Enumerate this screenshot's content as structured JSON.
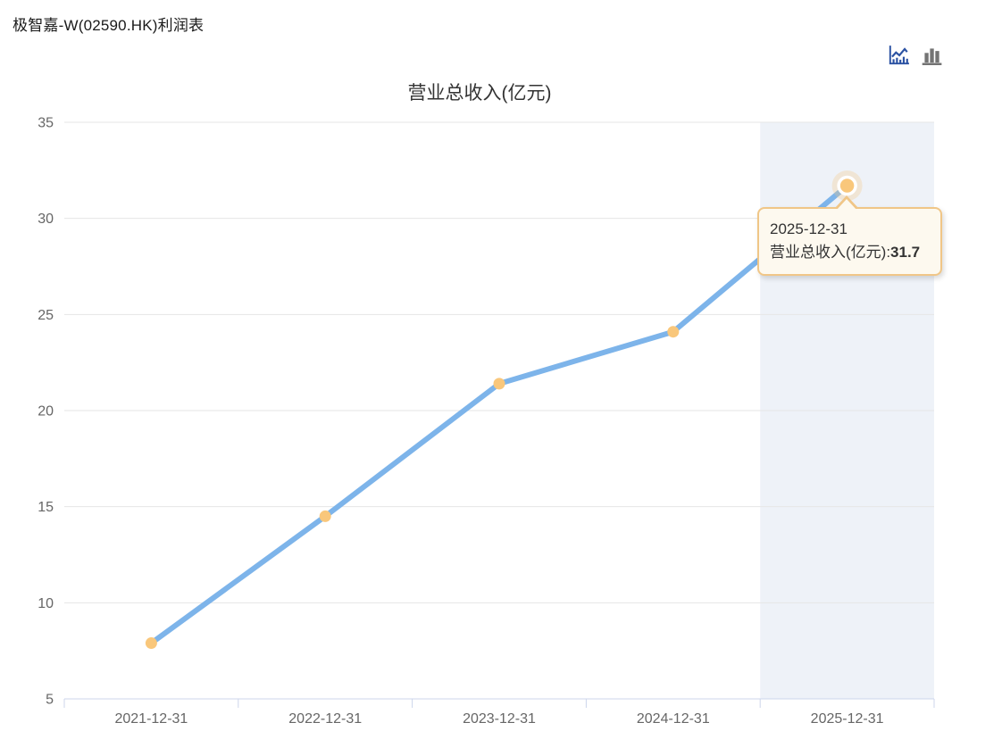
{
  "page": {
    "title": "极智嘉-W(02590.HK)利润表"
  },
  "toolbar": {
    "icons": [
      {
        "name": "line-chart-icon",
        "active": true,
        "color": "#2b52a3"
      },
      {
        "name": "bar-chart-icon",
        "active": false,
        "color": "#737373"
      }
    ]
  },
  "chart_data": {
    "type": "line",
    "title": "营业总收入(亿元)",
    "xlabel": "",
    "ylabel": "",
    "categories": [
      "2021-12-31",
      "2022-12-31",
      "2023-12-31",
      "2024-12-31",
      "2025-12-31"
    ],
    "series": [
      {
        "name": "营业总收入(亿元)",
        "values": [
          7.9,
          14.5,
          21.4,
          24.1,
          31.7
        ]
      }
    ],
    "ylim": [
      5,
      35
    ],
    "yticks": [
      5,
      10,
      15,
      20,
      25,
      30,
      35
    ],
    "grid": true,
    "legend": "none",
    "highlight": {
      "index": 4,
      "band_start_index": 4
    },
    "colors": {
      "line": "#7db4ea",
      "point": "#f9c77b",
      "grid": "#e6e6e6",
      "axis": "#ccd6eb",
      "label": "#666666",
      "band": "#eef2f8"
    }
  },
  "tooltip": {
    "date": "2025-12-31",
    "label": "营业总收入(亿元):",
    "value": "31.7",
    "colors": {
      "bg": "#fdf9ef",
      "border": "#f0c687"
    }
  }
}
